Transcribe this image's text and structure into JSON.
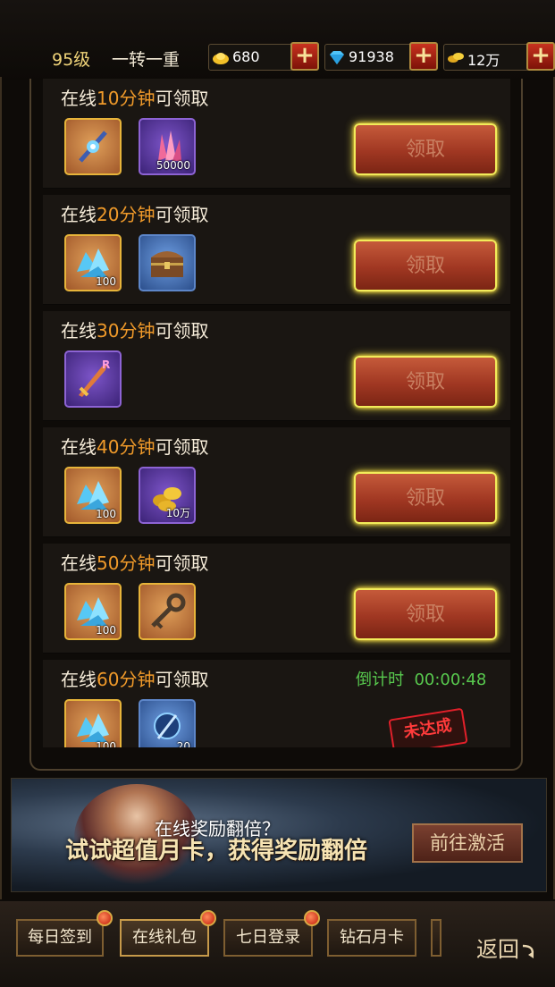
{
  "header": {
    "level": "95级",
    "rank": "一转一重",
    "currencies": [
      {
        "name": "gold-ingot",
        "value": "680"
      },
      {
        "name": "diamond",
        "value": "91938"
      },
      {
        "name": "coins",
        "value": "12万"
      }
    ],
    "plus_label": "+"
  },
  "rewards": [
    {
      "prefix": "在线",
      "time": "10分钟",
      "suffix": "可领取",
      "items": [
        {
          "icon": "jeweled-staff-icon",
          "qty": ""
        },
        {
          "icon": "pink-crystal-icon",
          "qty": "50000"
        }
      ],
      "action": "领取"
    },
    {
      "prefix": "在线",
      "time": "20分钟",
      "suffix": "可领取",
      "items": [
        {
          "icon": "blue-crystal-icon",
          "qty": "100"
        },
        {
          "icon": "treasure-chest-icon",
          "qty": ""
        }
      ],
      "action": "领取"
    },
    {
      "prefix": "在线",
      "time": "30分钟",
      "suffix": "可领取",
      "items": [
        {
          "icon": "sword-icon",
          "qty": "",
          "badge": "R"
        }
      ],
      "action": "领取"
    },
    {
      "prefix": "在线",
      "time": "40分钟",
      "suffix": "可领取",
      "items": [
        {
          "icon": "blue-crystal-icon",
          "qty": "100"
        },
        {
          "icon": "gold-coins-icon",
          "qty": "10万"
        }
      ],
      "action": "领取"
    },
    {
      "prefix": "在线",
      "time": "50分钟",
      "suffix": "可领取",
      "items": [
        {
          "icon": "blue-crystal-icon",
          "qty": "100"
        },
        {
          "icon": "key-icon",
          "qty": ""
        }
      ],
      "action": "领取"
    },
    {
      "prefix": "在线",
      "time": "60分钟",
      "suffix": "可领取",
      "items": [
        {
          "icon": "blue-crystal-icon",
          "qty": "100"
        },
        {
          "icon": "blue-orb-staff-icon",
          "qty": "20"
        }
      ],
      "countdown_label": "倒计时",
      "countdown": "00:00:48",
      "status": "未达成"
    }
  ],
  "banner": {
    "line1": "在线奖励翻倍？",
    "line2": "试试超值月卡，获得奖励翻倍",
    "button": "前往激活"
  },
  "tabs": [
    {
      "label": "每日签到",
      "dot": true
    },
    {
      "label": "在线礼包",
      "dot": true,
      "active": true
    },
    {
      "label": "七日登录",
      "dot": true
    },
    {
      "label": "钻石月卡",
      "dot": false
    }
  ],
  "back_label": "返回",
  "colors": {
    "highlight": "#f09a2a",
    "countdown": "#58c94e",
    "stamp": "#e2202a"
  }
}
